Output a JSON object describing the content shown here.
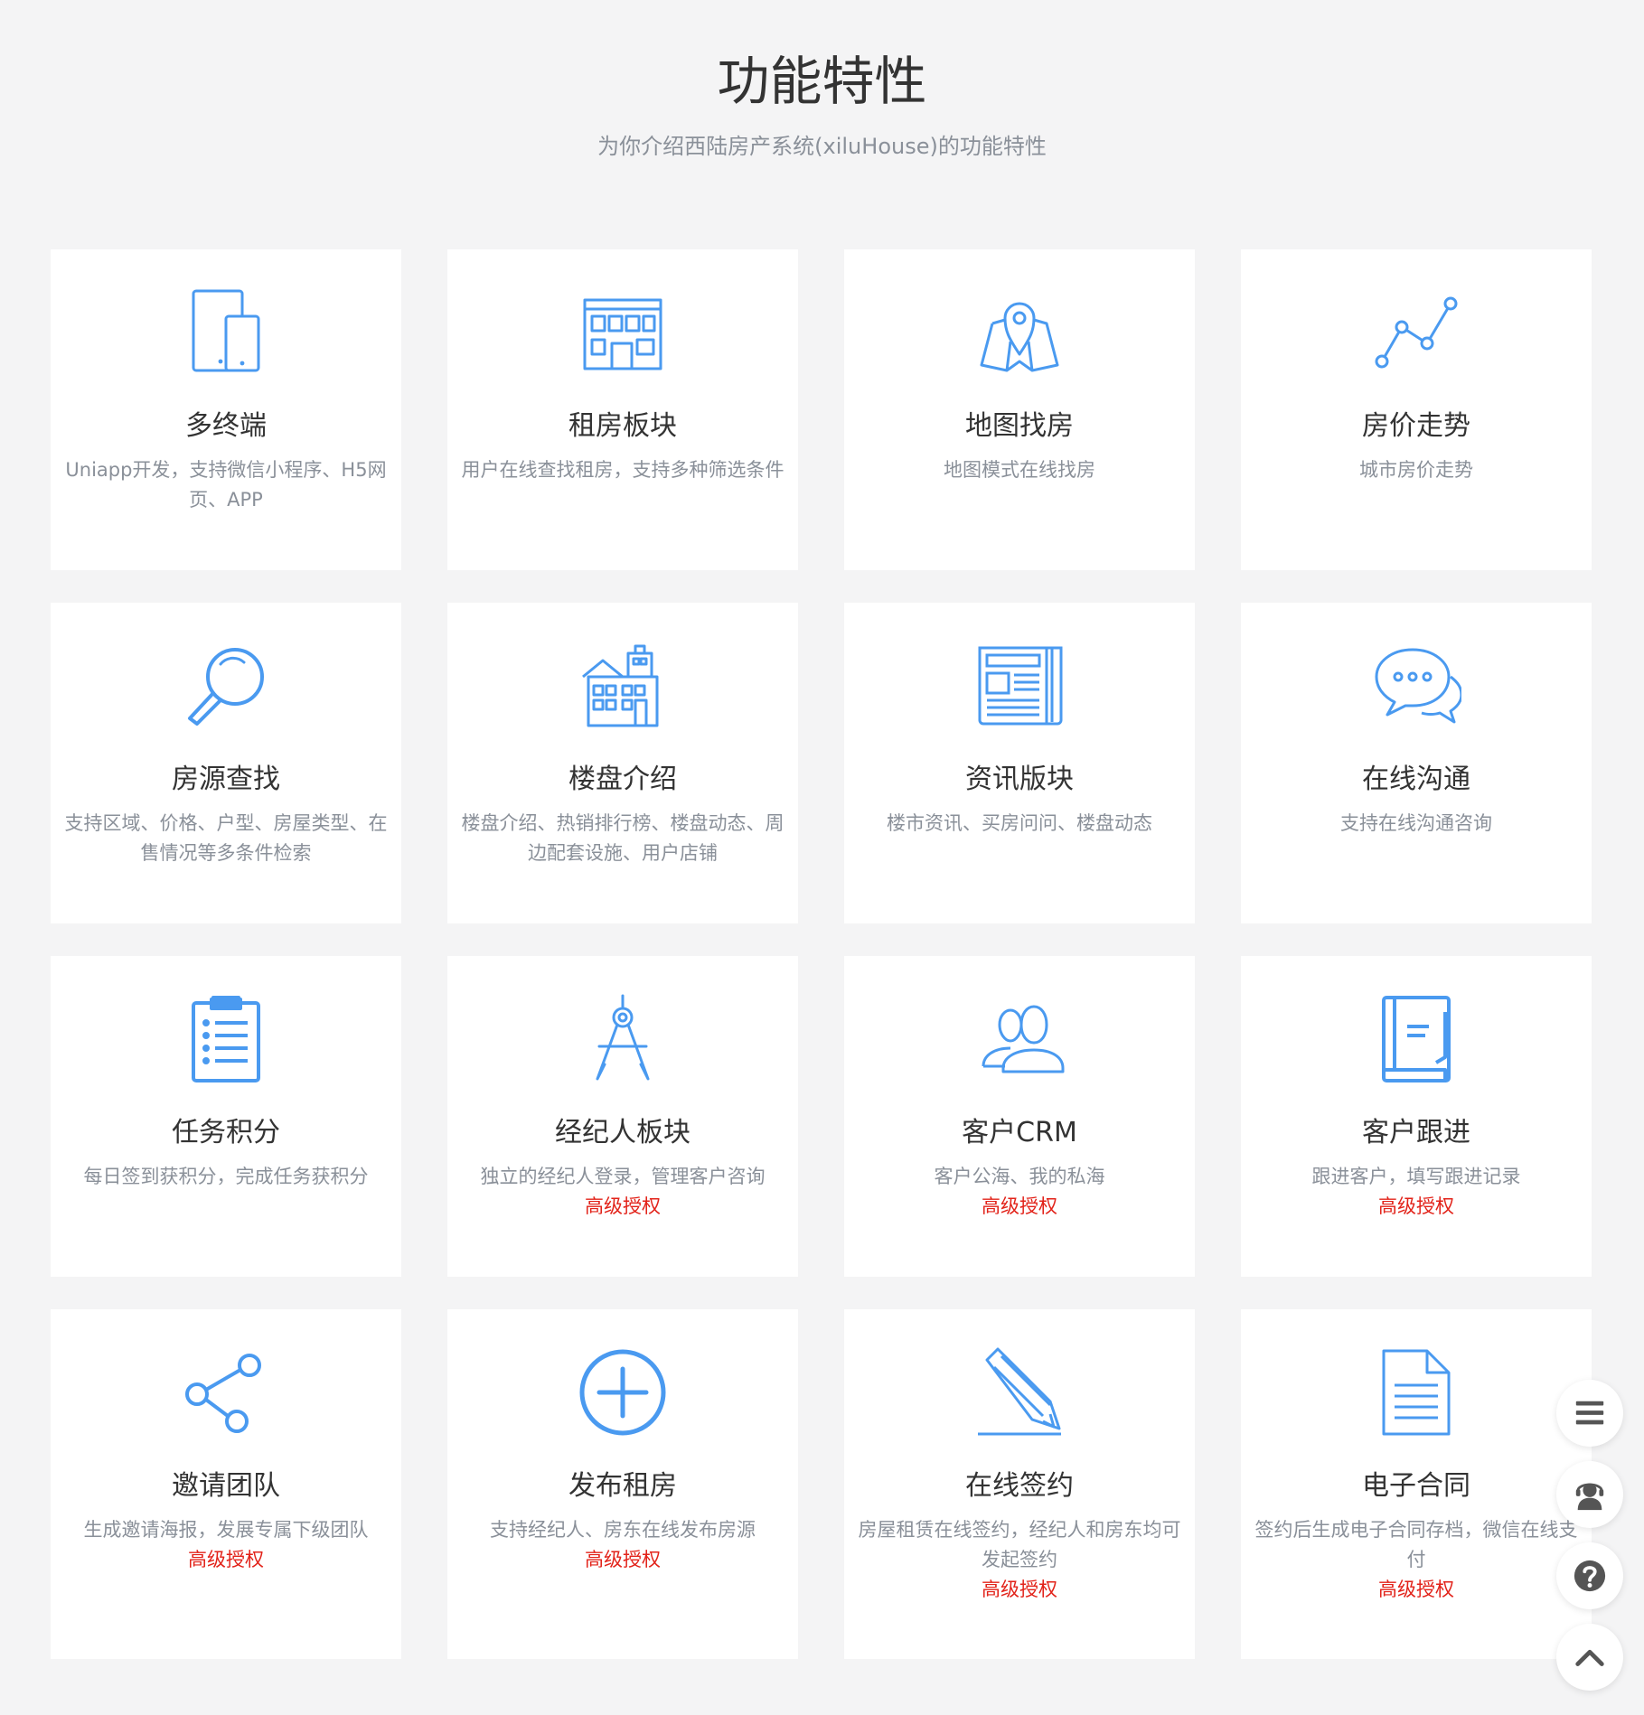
{
  "header": {
    "title": "功能特性",
    "subtitle": "为你介绍西陆房产系统(xiluHouse)的功能特性"
  },
  "colors": {
    "icon_blue": "#4a9af0",
    "badge_red": "#e2231a",
    "title_text": "#333333",
    "muted_text": "#8a9099",
    "page_bg": "#f4f4f5",
    "card_bg": "#ffffff"
  },
  "features": [
    {
      "icon": "devices-icon",
      "title": "多终端",
      "desc": "Uniapp开发，支持微信小程序、H5网页、APP",
      "badge": ""
    },
    {
      "icon": "building-icon",
      "title": "租房板块",
      "desc": "用户在线查找租房，支持多种筛选条件",
      "badge": ""
    },
    {
      "icon": "map-pin-icon",
      "title": "地图找房",
      "desc": "地图模式在线找房",
      "badge": ""
    },
    {
      "icon": "trend-line-icon",
      "title": "房价走势",
      "desc": "城市房价走势",
      "badge": ""
    },
    {
      "icon": "magnifier-icon",
      "title": "房源查找",
      "desc": "支持区域、价格、户型、房屋类型、在售情况等多条件检索",
      "badge": ""
    },
    {
      "icon": "apartment-icon",
      "title": "楼盘介绍",
      "desc": "楼盘介绍、热销排行榜、楼盘动态、周边配套设施、用户店铺",
      "badge": ""
    },
    {
      "icon": "newspaper-icon",
      "title": "资讯版块",
      "desc": "楼市资讯、买房问问、楼盘动态",
      "badge": ""
    },
    {
      "icon": "chat-bubbles-icon",
      "title": "在线沟通",
      "desc": "支持在线沟通咨询",
      "badge": ""
    },
    {
      "icon": "clipboard-list-icon",
      "title": "任务积分",
      "desc": "每日签到获积分，完成任务获积分",
      "badge": ""
    },
    {
      "icon": "compass-drafting-icon",
      "title": "经纪人板块",
      "desc": "独立的经纪人登录，管理客户咨询",
      "badge": "高级授权"
    },
    {
      "icon": "users-icon",
      "title": "客户CRM",
      "desc": "客户公海、我的私海",
      "badge": "高级授权"
    },
    {
      "icon": "book-icon",
      "title": "客户跟进",
      "desc": "跟进客户，填写跟进记录",
      "badge": "高级授权"
    },
    {
      "icon": "share-icon",
      "title": "邀请团队",
      "desc": "生成邀请海报，发展专属下级团队",
      "badge": "高级授权"
    },
    {
      "icon": "plus-circle-icon",
      "title": "发布租房",
      "desc": "支持经纪人、房东在线发布房源",
      "badge": "高级授权"
    },
    {
      "icon": "pencil-icon",
      "title": "在线签约",
      "desc": "房屋租赁在线签约，经纪人和房东均可发起签约",
      "badge": "高级授权"
    },
    {
      "icon": "document-icon",
      "title": "电子合同",
      "desc": "签约后生成电子合同存档，微信在线支付",
      "badge": "高级授权"
    }
  ],
  "float_buttons": [
    {
      "name": "menu-button",
      "icon": "menu-icon"
    },
    {
      "name": "support-button",
      "icon": "support-agent-icon"
    },
    {
      "name": "help-button",
      "icon": "question-icon"
    },
    {
      "name": "back-to-top-button",
      "icon": "chevron-up-icon"
    }
  ]
}
